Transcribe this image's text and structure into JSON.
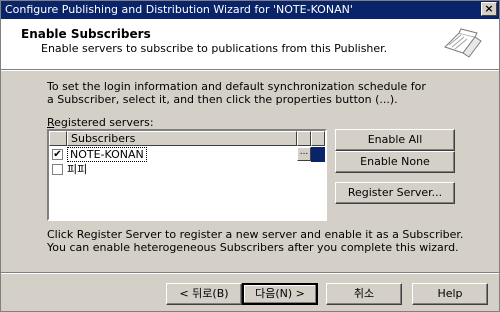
{
  "window": {
    "title": "Configure Publishing and Distribution Wizard for 'NOTE-KONAN'",
    "close_label": "×"
  },
  "header": {
    "title": "Enable Subscribers",
    "subtitle": "Enable servers to subscribe to publications from this Publisher."
  },
  "intro_text": "To set the login information and default synchronization schedule for a Subscriber, select it, and then click the properties button (...).",
  "registered": {
    "label_accel": "R",
    "label_rest": "egistered servers:",
    "column_header": "Subscribers",
    "rows": [
      {
        "name": "NOTE-KONAN",
        "checked": true,
        "selected": true,
        "check_mark": "✔",
        "properties_label": "..."
      },
      {
        "name": "피피",
        "checked": false,
        "selected": false
      }
    ]
  },
  "side_buttons": {
    "enable_all": "Enable All",
    "enable_none": "Enable None",
    "register_server": "Register Server..."
  },
  "footer_text": "Click Register Server to register a new server and enable it as a Subscriber. You can enable heterogeneous Subscribers after you complete this wizard.",
  "nav_buttons": {
    "back": "< 뒤로(B)",
    "next": "다음(N) >",
    "cancel": "취소",
    "help": "Help"
  }
}
